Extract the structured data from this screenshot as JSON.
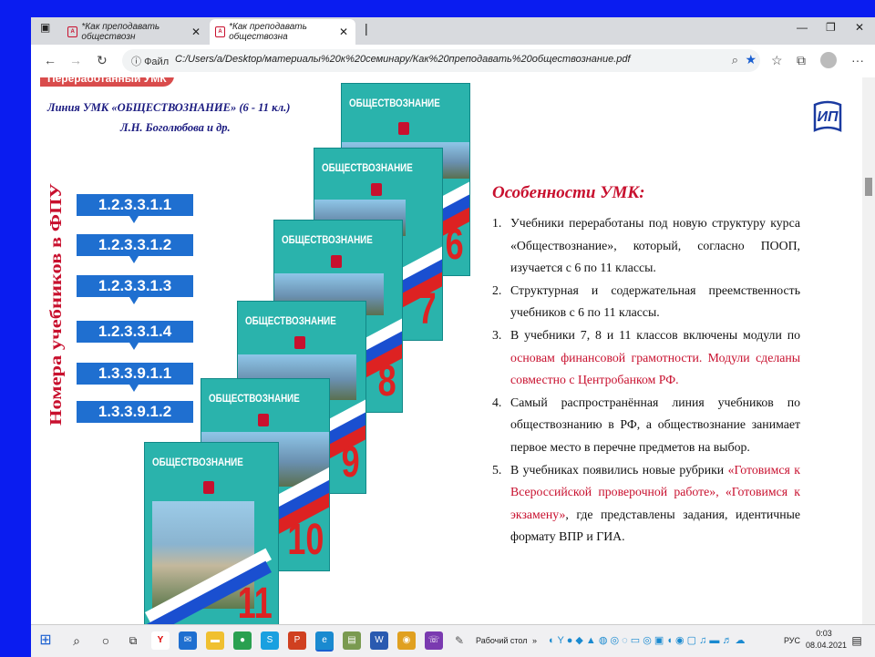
{
  "browser": {
    "tabs": [
      {
        "label": "*Как преподавать обществозн"
      },
      {
        "label": "*Как преподавать обществозна"
      }
    ],
    "address_prefix": "Файл",
    "url": "C:/Users/a/Desktop/материалы%20к%20семинару/Как%20преподавать%20обществознание.pdf"
  },
  "slide": {
    "badge": "Переработанный УМК",
    "line_title": "Линия УМК «ОБЩЕСТВОЗНАНИЕ» (6 - 11 кл.)",
    "authors": "Л.Н. Боголюбова и др.",
    "vertical_label": "Номера учебников в ФПУ",
    "codes": [
      "1.2.3.3.1.1",
      "1.2.3.3.1.2",
      "1.2.3.3.1.3",
      "1.2.3.3.1.4",
      "1.3.3.9.1.1",
      "1.3.3.9.1.2"
    ],
    "books": [
      {
        "title": "ОБЩЕСТВОЗНАНИЕ",
        "grade": "6"
      },
      {
        "title": "ОБЩЕСТВОЗНАНИЕ",
        "grade": "7"
      },
      {
        "title": "ОБЩЕСТВОЗНАНИЕ",
        "grade": "8"
      },
      {
        "title": "ОБЩЕСТВОЗНАНИЕ",
        "grade": "9"
      },
      {
        "title": "ОБЩЕСТВОЗНАНИЕ",
        "grade": "10"
      },
      {
        "title": "ОБЩЕСТВОЗНАНИЕ",
        "grade": "11"
      }
    ],
    "logo": "ИП",
    "features_title": "Особенности УМК:",
    "features": [
      {
        "n": "1.",
        "parts": [
          {
            "t": "Учебники переработаны под новую структуру курса «Обществознание», который, согласно ПООП, изучается с 6 по 11 классы.",
            "red": false
          }
        ]
      },
      {
        "n": "2.",
        "parts": [
          {
            "t": "Структурная и содержательная преемственность учебников с 6 по 11 классы.",
            "red": false
          }
        ]
      },
      {
        "n": "3.",
        "parts": [
          {
            "t": "В учебники 7, 8 и 11 классов включены модули по ",
            "red": false
          },
          {
            "t": "основам финансовой грамотности. Модули сделаны совместно с Центробанком РФ.",
            "red": true
          }
        ]
      },
      {
        "n": "4.",
        "parts": [
          {
            "t": "Самый распространённая линия учебников по обществознанию в РФ, а обществознание занимает первое место в перечне предметов на выбор.",
            "red": false
          }
        ]
      },
      {
        "n": "5.",
        "parts": [
          {
            "t": "В учебниках появились новые рубрики ",
            "red": false
          },
          {
            "t": "«Готовимся к Всероссийской проверочной работе», «Готовимся к экзамену»",
            "red": true
          },
          {
            "t": ", где представлены задания, идентичные формату ВПР и ГИА.",
            "red": false
          }
        ]
      }
    ]
  },
  "taskbar": {
    "desktop_label": "Рабочий стол",
    "lang": "РУС",
    "time": "0:03",
    "date": "08.04.2021"
  }
}
